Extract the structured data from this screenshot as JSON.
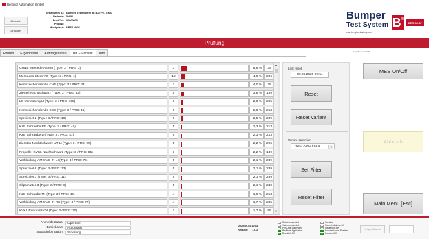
{
  "window": {
    "title": "Berghof Automation GmbH",
    "controls": "—"
  },
  "header": {
    "buttons": {
      "abbruch": "Abbruch",
      "drucken": "Drucken"
    },
    "info": [
      {
        "key": "Testsystem ID:",
        "value": "Bumper Testsystem an BATPE1 EPA"
      },
      {
        "key": "Variante:",
        "value": "5H4H"
      },
      {
        "key": "ProdCnt:",
        "value": "00000000"
      },
      {
        "key": "ProdNr:",
        "value": ""
      },
      {
        "key": "Workplace:",
        "value": "BRFEAP06"
      }
    ],
    "logo": {
      "line1": "Bumper",
      "line2": "Test System",
      "url": "www.berghof-testing.com",
      "mark": "B",
      "mark_sup": "®",
      "brand": "BERGHOF"
    }
  },
  "title_bar": "Prüfung",
  "tabs": [
    {
      "label": "Prüfen",
      "active": false
    },
    {
      "label": "Ergebnisse",
      "active": false
    },
    {
      "label": "Auftragsdaten",
      "active": false
    },
    {
      "label": "NIO-Statistik",
      "active": true
    },
    {
      "label": "Info",
      "active": false
    }
  ],
  "right_caption": "Ausgabe Laserlicht",
  "statistics": [
    {
      "name": "CHNE Mercedes-Stern (Type: 3 / PRG: 3)",
      "count": "3",
      "pct": "8,6 %",
      "total": "35",
      "fill": 0.086
    },
    {
      "name": "Mercedes-Stern VO (Type: 3 / PRG: 1)",
      "count": "10",
      "pct": "4,9 %",
      "total": "206",
      "fill": 0.049
    },
    {
      "name": "Kennzeichenblende CHE (Type: 3 / PRG: 44)",
      "count": "1",
      "pct": "4,0 %",
      "total": "25",
      "fill": 0.04
    },
    {
      "name": "Zierteil Nachtschwarz (Type: 3 / PRG: 32)",
      "count": "5",
      "pct": "3,6 %",
      "total": "139",
      "fill": 0.036
    },
    {
      "name": "LS-Verrastung LI (Type: 3 / PRG: 105)",
      "count": "6",
      "pct": "2,9 %",
      "total": "205",
      "fill": 0.029
    },
    {
      "name": "Kennzeichenblende ECE (Type: 3 / PRG: 41)",
      "count": "6",
      "pct": "2,8 %",
      "total": "213",
      "fill": 0.028
    },
    {
      "name": "Spreizniet 2 (Type: 3 / PRG: 10)",
      "count": "6",
      "pct": "2,5 %",
      "total": "239",
      "fill": 0.025
    },
    {
      "name": "KZB Schraube RE (Type: 3 / PRG: 40)",
      "count": "5",
      "pct": "2,3 %",
      "total": "213",
      "fill": 0.023
    },
    {
      "name": "KZB Schraube LI (Type: 3 / PRG: 41)",
      "count": "5",
      "pct": "2,3 %",
      "total": "213",
      "fill": 0.023
    },
    {
      "name": "Zierstab Nachtschwarz UT LI (Type: 3 / PRG: 95)",
      "count": "5",
      "pct": "2,2 %",
      "total": "225",
      "fill": 0.022
    },
    {
      "name": "Propeller KVKL Nachtschwarz (Type: 3 / PRG: 85)",
      "count": "3",
      "pct": "2,2 %",
      "total": "139",
      "fill": 0.022
    },
    {
      "name": "Verkleidung AMG VO IN LI (Type: 3 / PRG: 76)",
      "count": "5",
      "pct": "2,1 %",
      "total": "239",
      "fill": 0.021
    },
    {
      "name": "Spreizniet 6 (Type: 3 / PRG: 13)",
      "count": "5",
      "pct": "2,1 %",
      "total": "239",
      "fill": 0.021
    },
    {
      "name": "Spreizniet 3 (Type: 3 / PRG: 11)",
      "count": "5",
      "pct": "2,1 %",
      "total": "239",
      "fill": 0.021
    },
    {
      "name": "Clipsmutter 3 (Type: 3 / PRG: 9)",
      "count": "5",
      "pct": "2,1 %",
      "total": "240",
      "fill": 0.021
    },
    {
      "name": "KZB Schraube MI (Type: 3 / PRG: 46)",
      "count": "4",
      "pct": "1,9 %",
      "total": "213",
      "fill": 0.019
    },
    {
      "name": "Verkleidung AMG VO IN RE (Type: 3 / PRG: 77)",
      "count": "4",
      "pct": "1,7 %",
      "total": "235",
      "fill": 0.017
    },
    {
      "name": "KVKL Rundumsicht (Type: 3 / PRG: 20)",
      "count": "1",
      "pct": "1,7 %",
      "total": "59",
      "fill": 0.017
    }
  ],
  "side_panel": {
    "last_reset_label": "Last reset",
    "last_reset_value": "09.06.2020  09:54",
    "reset_button": "Reset",
    "reset_variant_button": "Reset variant",
    "variant_selection_label": "Variant selection",
    "variant_selected": "H247 AMG Front",
    "set_filter_button": "Set Filter",
    "reset_filter_button": "Reset Filter"
  },
  "right_buttons": {
    "mes": "MES On/Off",
    "abbruch": "Abbruch",
    "main_menu": "Main Menu [Esc]"
  },
  "footer": {
    "status": [
      {
        "key": "Anmeldestatus:",
        "value": "Operator"
      },
      {
        "key": "Betriebsart:",
        "value": "Automatik"
      },
      {
        "key": "Statusinformation:",
        "value": "Stoerung"
      }
    ],
    "datetime": "2020-06-02 10:41",
    "version_label": "Version:",
    "version_value": "1.8.2",
    "leds_col1": [
      {
        "label": "Robot connected",
        "on": false
      },
      {
        "label": "Vision connected",
        "on": false
      },
      {
        "label": "Print-App connected",
        "on": false
      },
      {
        "label": "Realtime-Application",
        "on": true
      },
      {
        "label": "Druckluft OK",
        "on": true
      }
    ],
    "leds_col2": [
      {
        "label": "Not-Aus",
        "on": false
      },
      {
        "label": "Sicherheitskreis OK",
        "on": false
      },
      {
        "label": "Steuerung EIN",
        "on": false
      },
      {
        "label": "Roboter Home-Position",
        "on": true
      },
      {
        "label": "Roboter OK",
        "on": true
      }
    ],
    "small_button": "Freigabe Dauerb."
  }
}
